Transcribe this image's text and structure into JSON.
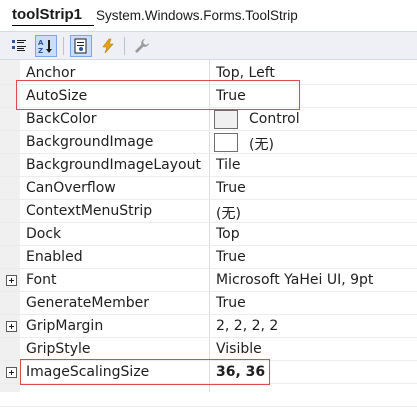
{
  "header": {
    "object_name": "toolStrip1",
    "object_type": "System.Windows.Forms.ToolStrip"
  },
  "toolbar": {
    "buttons": [
      {
        "icon": "categorized-icon",
        "pressed": false
      },
      {
        "icon": "alphabetical-icon",
        "pressed": true
      },
      {
        "icon": "properties-icon",
        "pressed": true
      },
      {
        "icon": "events-lightning-icon",
        "pressed": false
      },
      {
        "icon": "property-pages-wrench-icon",
        "pressed": false
      }
    ]
  },
  "properties": [
    {
      "name": "Anchor",
      "value": "Top, Left"
    },
    {
      "name": "AutoSize",
      "value": "True"
    },
    {
      "name": "BackColor",
      "value": "Control"
    },
    {
      "name": "BackgroundImage",
      "value": "(无)"
    },
    {
      "name": "BackgroundImageLayout",
      "value": "Tile"
    },
    {
      "name": "CanOverflow",
      "value": "True"
    },
    {
      "name": "ContextMenuStrip",
      "value": "(无)"
    },
    {
      "name": "Dock",
      "value": "Top"
    },
    {
      "name": "Enabled",
      "value": "True"
    },
    {
      "name": "Font",
      "value": "Microsoft YaHei UI, 9pt"
    },
    {
      "name": "GenerateMember",
      "value": "True"
    },
    {
      "name": "GripMargin",
      "value": "2, 2, 2, 2"
    },
    {
      "name": "GripStyle",
      "value": "Visible"
    },
    {
      "name": "ImageScalingSize",
      "value": "36, 36"
    }
  ],
  "colors": {
    "highlight_border": "#e04a4a",
    "pressed_button": "#c9defb",
    "toolbar_background": "#eef0f5"
  }
}
